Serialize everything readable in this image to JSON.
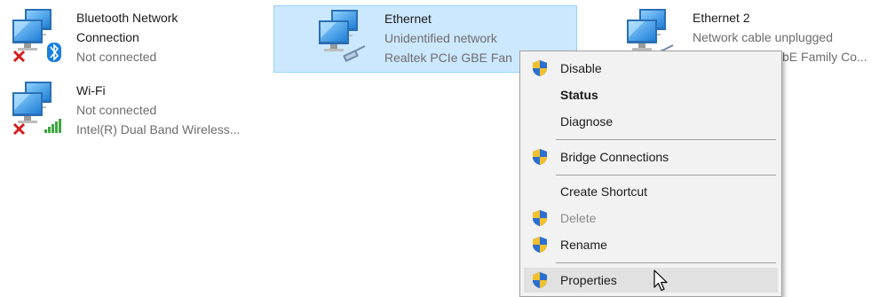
{
  "connections": [
    {
      "name_line1": "Bluetooth Network",
      "name_line2": "Connection",
      "status": "Not connected",
      "icon": "network-computers-bluetooth-icon",
      "status_icon": "red-x-icon"
    },
    {
      "name": "Wi-Fi",
      "status": "Not connected",
      "adapter": "Intel(R) Dual Band Wireless...",
      "icon": "network-computers-wifi-icon",
      "status_icon": "red-x-icon"
    },
    {
      "name": "Ethernet",
      "status": "Unidentified network",
      "adapter": "Realtek PCIe GBE Family...",
      "adapter_visible": "Realtek PCIe GBE Fan",
      "icon": "network-computers-ethernet-icon",
      "selected": true
    },
    {
      "name": "Ethernet 2",
      "status": "Network cable unplugged",
      "adapter_visible": "bE Family Co...",
      "icon": "network-computers-ethernet-icon"
    }
  ],
  "context_menu": {
    "items": [
      {
        "label": "Disable",
        "shield": true
      },
      {
        "label": "Status",
        "bold": true
      },
      {
        "label": "Diagnose"
      },
      {
        "label": "Bridge Connections",
        "shield": true
      },
      {
        "label": "Create Shortcut"
      },
      {
        "label": "Delete",
        "shield": true,
        "disabled": true
      },
      {
        "label": "Rename",
        "shield": true
      },
      {
        "label": "Properties",
        "shield": true,
        "hovered": true
      }
    ]
  },
  "colors": {
    "selection_bg": "#cce8ff",
    "selection_border": "#99d1ff",
    "menu_bg": "#f2f2f2",
    "hover_bg": "#e1e1e1",
    "status_text": "#6d6d6d"
  }
}
